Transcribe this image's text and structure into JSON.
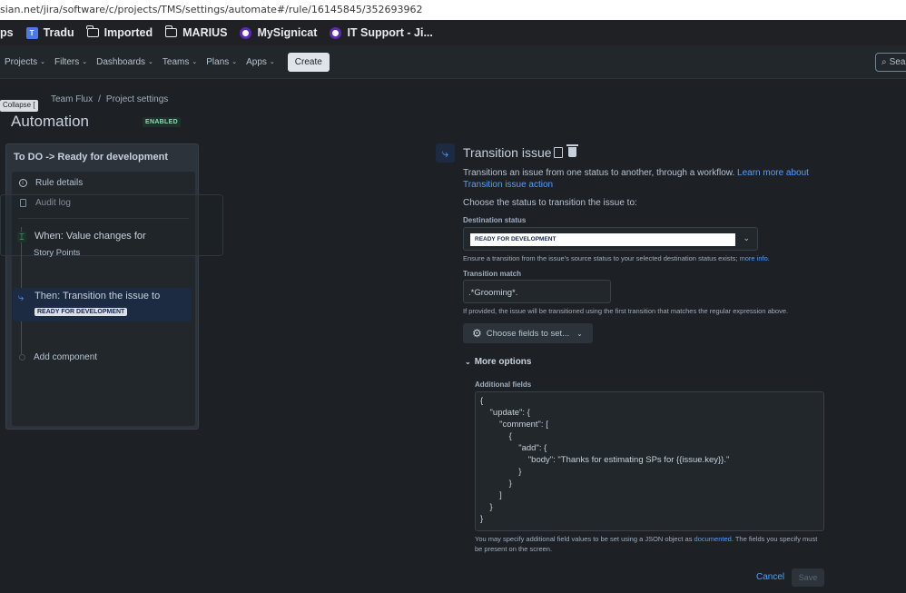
{
  "browser": {
    "url": "sian.net/jira/software/c/projects/TMS/settings/automate#/rule/16145845/352693962",
    "bookmarks": [
      {
        "label": "ps",
        "icon": "apps-icon"
      },
      {
        "label": "Tradu",
        "icon": "translate-icon"
      },
      {
        "label": "Imported",
        "icon": "folder-icon"
      },
      {
        "label": "MARIUS",
        "icon": "folder-icon"
      },
      {
        "label": "MySignicat",
        "icon": "signicat-icon"
      },
      {
        "label": "IT Support - Ji...",
        "icon": "signicat-icon"
      }
    ]
  },
  "nav": {
    "items": [
      "Projects",
      "Filters",
      "Dashboards",
      "Teams",
      "Plans",
      "Apps"
    ],
    "create_label": "Create",
    "search_placeholder": "Sea"
  },
  "breadcrumb": {
    "items": [
      "Team Flux",
      "/",
      "Project settings"
    ]
  },
  "collapse_tooltip": "Collapse  [",
  "page": {
    "title": "Automation",
    "badge": "ENABLED"
  },
  "rule": {
    "title": "To DO -> Ready for development",
    "menu": {
      "rule_details": "Rule details",
      "audit_log": "Audit log"
    },
    "trigger": {
      "label": "When: Value changes for",
      "sub": "Story Points"
    },
    "action": {
      "label": "Then: Transition the issue to",
      "status": "READY FOR DEVELOPMENT"
    },
    "add_component": "Add component"
  },
  "config": {
    "title": "Transition issue",
    "description": "Transitions an issue from one status to another, through a workflow. ",
    "learn_more": "Learn more about Transition issue action",
    "choose_status": "Choose the status to transition the issue to:",
    "dest_label": "Destination status",
    "dest_value": "READY FOR DEVELOPMENT",
    "dest_help": "Ensure a transition from the issue's source status to your selected destination status exists; ",
    "more_info": "more info.",
    "match_label": "Transition match",
    "match_value": ".*Grooming*.",
    "match_help": "If provided, the issue will be transitioned using the first transition that matches the regular expression above.",
    "fields_button": "Choose fields to set...",
    "more_options": "More options",
    "additional_label": "Additional fields",
    "json_text": "{\n    \"update\": {\n        \"comment\": [\n            {\n                \"add\": {\n                    \"body\": \"Thanks for estimating SPs for {{issue.key}}.\"\n                }\n            }\n        ]\n    }\n}",
    "additional_help_1": "You may specify additional field values to be set using a JSON object as ",
    "documented": "documented",
    "additional_help_2": ". The fields you specify must be present on the screen.",
    "cancel_label": "Cancel",
    "save_label": "Save"
  }
}
